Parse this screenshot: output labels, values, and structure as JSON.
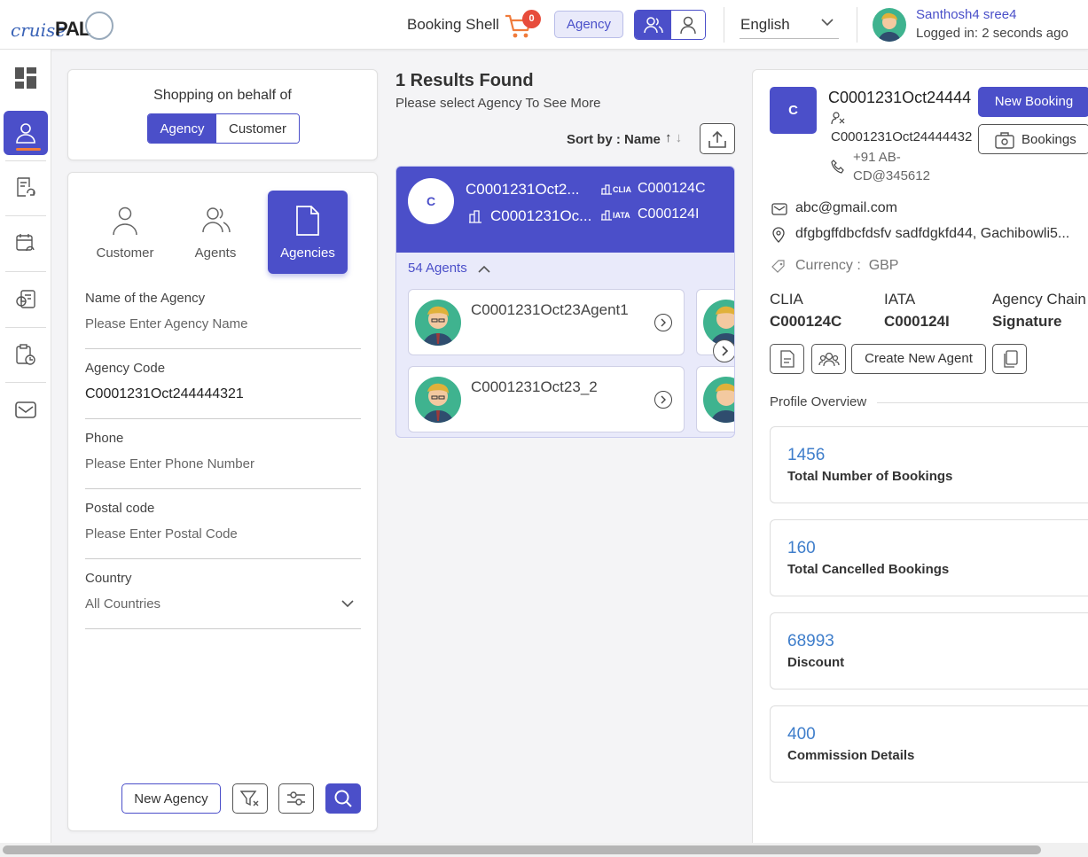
{
  "header": {
    "logo_prefix": "cruise",
    "logo_suffix": "PAL",
    "booking_shell": "Booking Shell",
    "cart_count": "0",
    "agency_pill": "Agency",
    "language": "English",
    "user_name": "Santhosh4 sree4",
    "logged_in": "Logged in: 2 seconds ago"
  },
  "sidebar": {
    "items": [
      "dashboard",
      "profile",
      "documents-refresh",
      "calendar-refresh",
      "cruise-stats",
      "clipboard-clock",
      "mail"
    ],
    "active": "profile"
  },
  "shopping": {
    "title": "Shopping on behalf of",
    "options": [
      "Agency",
      "Customer"
    ],
    "selected": "Agency"
  },
  "search": {
    "tabs": [
      "Customer",
      "Agents",
      "Agencies"
    ],
    "active_tab": "Agencies",
    "fields": {
      "agency_name": {
        "label": "Name of the Agency",
        "placeholder": "Please Enter Agency Name"
      },
      "agency_code": {
        "label": "Agency Code",
        "value": "C0001231Oct244444321"
      },
      "phone": {
        "label": "Phone",
        "placeholder": "Please Enter Phone Number"
      },
      "postal": {
        "label": "Postal code",
        "placeholder": "Please Enter Postal Code"
      },
      "country": {
        "label": "Country",
        "value": "All Countries"
      }
    },
    "new_agency": "New Agency"
  },
  "results": {
    "title": "1 Results Found",
    "subtitle": "Please select Agency To See More",
    "sort_label": "Sort by :",
    "sort_field": "Name",
    "card": {
      "initial": "C",
      "name": "C0001231Oct2...",
      "code": "C0001231Oc...",
      "clia_tag": "CLIA",
      "clia": "C000124C",
      "iata_tag": "IATA",
      "iata": "C000124I",
      "agents_count": "54 Agents",
      "agents": [
        "C0001231Oct23Agent1",
        "C0001231Oct23_2"
      ]
    }
  },
  "detail": {
    "initial": "C",
    "name": "C0001231Oct24444",
    "code": "C0001231Oct24444432",
    "phone": "+91 AB-CD@345612",
    "email": "abc@gmail.com",
    "address": "dfgbgffdbcfdsfv sadfdgkfd44, Gachibowli5...",
    "currency_label": "Currency :",
    "currency": "GBP",
    "new_booking": "New Booking",
    "bookings": "Bookings",
    "clia_label": "CLIA",
    "clia": "C000124C",
    "iata_label": "IATA",
    "iata": "C000124I",
    "chain_label": "Agency Chain",
    "chain": "Signature",
    "create_agent": "Create New Agent",
    "overview_title": "Profile Overview",
    "stats": [
      {
        "value": "1456",
        "label": "Total Number of Bookings"
      },
      {
        "value": "160",
        "label": "Total Cancelled Bookings"
      },
      {
        "value": "68993",
        "label": "Discount"
      },
      {
        "value": "400",
        "label": "Commission Details"
      }
    ]
  },
  "colors": {
    "primary": "#4b4fc9",
    "accent": "#f07b3b",
    "link": "#3f7ecb",
    "badge": "#e74c3c"
  }
}
